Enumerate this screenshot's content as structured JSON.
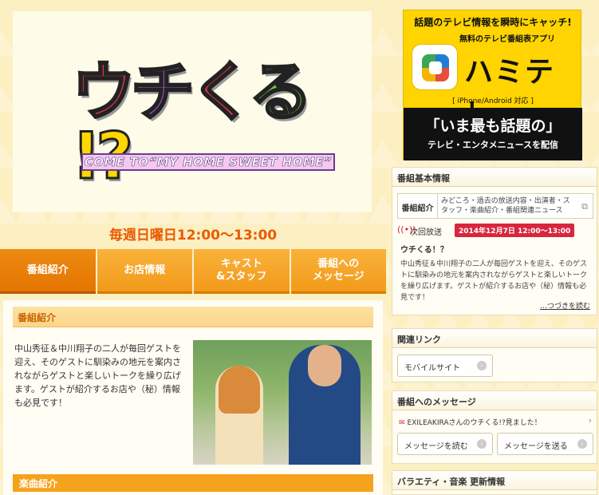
{
  "hero": {
    "logo_chars": [
      "ウ",
      "チ",
      "く",
      "る",
      "!?"
    ],
    "logo_subtitle": "COME TO“MY HOME SWEET HOME”"
  },
  "schedule": "毎週日曜日12:00〜13:00",
  "tabs": [
    {
      "label": "番組紹介",
      "active": true
    },
    {
      "label": "お店情報",
      "active": false
    },
    {
      "label": "キャスト\n&スタッフ",
      "active": false
    },
    {
      "label": "番組への\nメッセージ",
      "active": false
    }
  ],
  "section": {
    "title": "番組紹介",
    "intro": "中山秀征＆中川翔子の二人が毎回ゲストを迎え、そのゲストに馴染みの地元を案内されながらゲストと楽しいトークを繰り広げます。ゲストが紹介するお店や（秘）情報も必見です！",
    "songs_title": "楽曲紹介"
  },
  "ad": {
    "line1": "話題のテレビ情報を瞬時にキャッチ!",
    "line2": "無料のテレビ番組表アプリ",
    "app_name": "ハミテレ",
    "platform": "[ iPhone/Android 対応 ]",
    "headline": "「いま最も話題の」",
    "subline": "テレビ・エンタメニュースを配信"
  },
  "info_box": {
    "title": "番組基本情報",
    "tab_label": "番組紹介",
    "tab_desc": "みどころ・過去の放送内容・出演者・スタッフ・楽曲紹介・番組関連ニュース",
    "next_label": "次回放送",
    "next_date": "2014年12月7日 12:00〜13:00",
    "show_title": "ウチくる！？",
    "show_desc": "中山秀征＆中川翔子の二人が毎回ゲストを迎え、そのゲストに馴染みの地元を案内されながらゲストと楽しいトークを繰り広げます。ゲストが紹介するお店や（秘）情報も必見です！",
    "more": "…つづきを読む"
  },
  "links_box": {
    "title": "関連リンク",
    "mobile": "モバイルサイト"
  },
  "message_box": {
    "title": "番組へのメッセージ",
    "latest": "EXILEAKIRAさんのウチくる!?見ました！",
    "read": "メッセージを読む",
    "send": "メッセージを送る"
  },
  "update_box": {
    "title": "バラエティ・音楽 更新情報"
  },
  "colors": {
    "accent": "#f29a1a",
    "schedule": "#e85b00",
    "badge": "#d7263d",
    "background": "#fcefc2"
  }
}
